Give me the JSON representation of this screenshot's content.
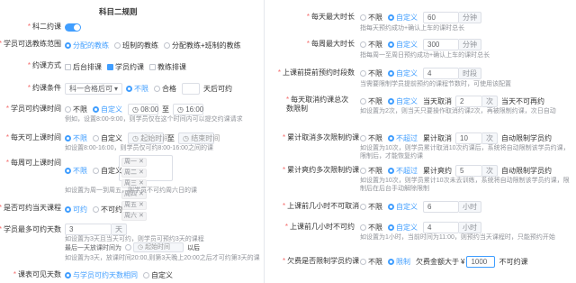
{
  "title": "科目二规则",
  "left": {
    "subject_enabled": {
      "label": "科二约课"
    },
    "coach_scope": {
      "label": "学员可选教练范围",
      "options": [
        "分配的教练",
        "班制的教练",
        "分配教练+班制的教练"
      ]
    },
    "booking_method": {
      "label": "约课方式",
      "options": [
        "后台排课",
        "学员约课",
        "教练排课"
      ]
    },
    "booking_condition": {
      "label": "约课条件",
      "select": "科一合格后可",
      "options": [
        "不限",
        "合格"
      ],
      "after": "天后可约"
    },
    "booking_time": {
      "label": "学员可约课时间",
      "options": [
        "不限",
        "自定义"
      ],
      "start": "08:00",
      "sep": "至",
      "end": "16:00",
      "hint": "例如，设置8:00-9:00，则学员仅在这个时间内可以提交约课请求"
    },
    "daily_time": {
      "label": "每天可上课时间",
      "options": [
        "不限",
        "自定义"
      ],
      "start_ph": "起始时间",
      "sep": "至",
      "end_ph": "结束时间",
      "hint": "如设置8:00-16:00，则学员仅可约8:00-16:00之间的课"
    },
    "weekly_time": {
      "label": "每周可上课时间",
      "options": [
        "不限",
        "自定义"
      ],
      "days": [
        "周一",
        "周二",
        "周三",
        "周四",
        "周五",
        "周六"
      ],
      "hint": "如设置为周一到周五，则学员不可约周六日的课"
    },
    "same_day": {
      "label": "是否可约当天课程",
      "options": [
        "可约",
        "不可约"
      ]
    },
    "days_ahead": {
      "label": "学员最多可约天数",
      "value": "3",
      "unit": "天",
      "hint1": "如设置为3天且当天可约，则学员可预约3天的课程",
      "hint2": "最后一天放课时间为",
      "start_ph": "起始时间",
      "after": "以后",
      "hint3": "如设置为3天，放课时间20:00,则第3天晚上20:00之后才可约第3天的课"
    },
    "visible_days": {
      "label": "课表可见天数",
      "options": [
        "与学员可约天数相同",
        "自定义"
      ]
    }
  },
  "right": {
    "daily_max": {
      "label": "每天最大时长",
      "options": [
        "不限",
        "自定义"
      ],
      "value": "60",
      "unit": "分钟",
      "hint": "指每天预约成功+确认上车的课时总长"
    },
    "weekly_max": {
      "label": "每周最大时长",
      "options": [
        "不限",
        "自定义"
      ],
      "value": "300",
      "unit": "分钟",
      "hint": "指每周一至周日预约成功+确认上车的课时总长"
    },
    "advance_hours": {
      "label": "上课前提前预约时段数",
      "options": [
        "不限",
        "自定义"
      ],
      "value": "4",
      "unit": "时段",
      "hint": "当需要限制学员提前预约的课程节数时，可使用该配置"
    },
    "cancel_count": {
      "label": "每天取消约课总次数限制",
      "options": [
        "不限",
        "自定义"
      ],
      "prefix": "当天取消",
      "value": "2",
      "unit": "次",
      "suffix": "当天不可再约",
      "hint": "如设置为2次，则当天只要操作取消约课2次，再被限制约课，次日自动"
    },
    "cumulative_cancel": {
      "label": "累计取消多次限制约课",
      "options": [
        "不限",
        "不超过"
      ],
      "prefix": "累计取消",
      "value": "10",
      "unit": "次",
      "suffix": "自动限制学员约",
      "hint": "如设置为10次，则学员累计取消10次约课后，系统将自动限制该学员约课，限制后，才能恢复约课"
    },
    "cumulative_miss": {
      "label": "累计爽约多次限制约课",
      "options": [
        "不限",
        "不超过"
      ],
      "prefix": "累计爽约",
      "value": "5",
      "unit": "次",
      "suffix": "自动限制学员约",
      "hint": "如设置为10次，则学员累计10次未去训练，系统将自动限制该学员约课，限制后在后台手动解除限制"
    },
    "no_cancel_before": {
      "label": "上课前几小时不可取消",
      "options": [
        "不限",
        "自定义"
      ],
      "value": "6",
      "unit": "小时"
    },
    "no_book_before": {
      "label": "上课前几小时不可约",
      "options": [
        "不限",
        "自定义"
      ],
      "value": "4",
      "unit": "小时",
      "hint": "如设置为1小时，当前时间为11:00，则预约当天课程时，只能预约开始"
    },
    "arrears_limit": {
      "label": "欠费是否限制学员约课",
      "options": [
        "不限",
        "限制"
      ],
      "prefix": "欠费金额大于",
      "currency": "¥",
      "value": "1000",
      "suffix": "不可约课"
    }
  }
}
